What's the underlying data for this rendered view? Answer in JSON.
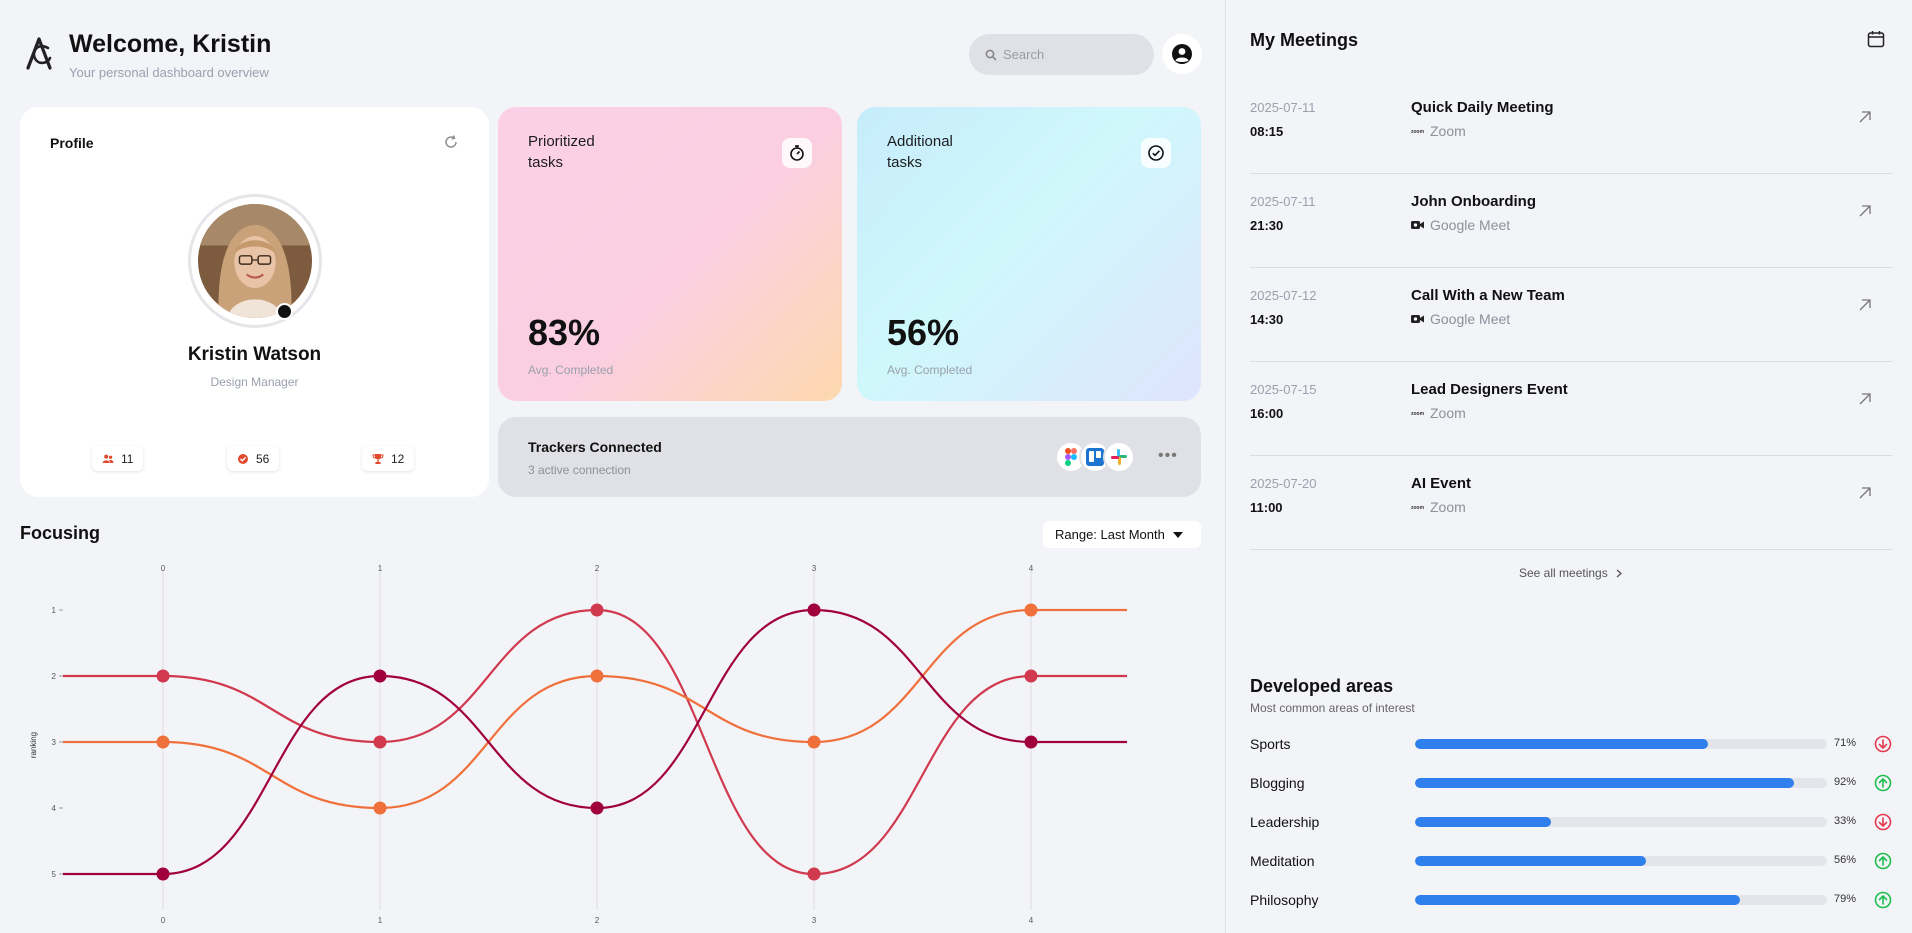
{
  "header": {
    "welcome": "Welcome, Kristin",
    "subtitle": "Your personal dashboard overview",
    "search_placeholder": "Search"
  },
  "profile": {
    "title": "Profile",
    "name": "Kristin Watson",
    "role": "Design Manager",
    "stats": [
      {
        "icon": "users-icon",
        "value": "11"
      },
      {
        "icon": "target-icon",
        "value": "56"
      },
      {
        "icon": "trophy-icon",
        "value": "12"
      }
    ]
  },
  "tasks": [
    {
      "label": "Prioritized tasks",
      "value": "83%",
      "sub": "Avg. Completed",
      "icon": "stopwatch-icon"
    },
    {
      "label": "Additional tasks",
      "value": "56%",
      "sub": "Avg. Completed",
      "icon": "check-circle-icon"
    }
  ],
  "trackers": {
    "title": "Trackers Connected",
    "subtitle": "3 active connection",
    "apps": [
      "figma-icon",
      "trello-icon",
      "slack-icon"
    ]
  },
  "focusing": {
    "title": "Focusing",
    "range_label": "Range: Last Month"
  },
  "chart_data": {
    "type": "line",
    "x": [
      0,
      1,
      2,
      3,
      4
    ],
    "x_ticks": [
      "0",
      "1",
      "2",
      "3",
      "4"
    ],
    "y_ticks": [
      "1",
      "2",
      "3",
      "4",
      "5"
    ],
    "ylabel": "ranking",
    "ylim": [
      1,
      5
    ],
    "y_reversed": true,
    "series": [
      {
        "color": "#d0394e",
        "values": [
          2,
          3,
          1,
          5,
          2
        ]
      },
      {
        "color": "#f0703c",
        "values": [
          3,
          4,
          2,
          3,
          1
        ]
      },
      {
        "color": "#a1003f",
        "values": [
          5,
          2,
          4,
          1,
          3
        ]
      }
    ]
  },
  "meetings": {
    "title": "My Meetings",
    "items": [
      {
        "date": "2025-07-11",
        "time": "08:15",
        "name": "Quick Daily Meeting",
        "platform": "Zoom",
        "platform_icon": "zoom-icon"
      },
      {
        "date": "2025-07-11",
        "time": "21:30",
        "name": "John Onboarding",
        "platform": "Google Meet",
        "platform_icon": "video-camera-icon"
      },
      {
        "date": "2025-07-12",
        "time": "14:30",
        "name": "Call With a New Team",
        "platform": "Google Meet",
        "platform_icon": "video-camera-icon"
      },
      {
        "date": "2025-07-15",
        "time": "16:00",
        "name": "Lead Designers Event",
        "platform": "Zoom",
        "platform_icon": "zoom-icon"
      },
      {
        "date": "2025-07-20",
        "time": "11:00",
        "name": "AI Event",
        "platform": "Zoom",
        "platform_icon": "zoom-icon"
      }
    ],
    "see_all": "See all meetings"
  },
  "developed_areas": {
    "title": "Developed areas",
    "subtitle": "Most common areas of interest",
    "items": [
      {
        "name": "Sports",
        "pct": "71%",
        "value": 71,
        "trend": "down"
      },
      {
        "name": "Blogging",
        "pct": "92%",
        "value": 92,
        "trend": "up"
      },
      {
        "name": "Leadership",
        "pct": "33%",
        "value": 33,
        "trend": "down"
      },
      {
        "name": "Meditation",
        "pct": "56%",
        "value": 56,
        "trend": "up"
      },
      {
        "name": "Philosophy",
        "pct": "79%",
        "value": 79,
        "trend": "up"
      }
    ]
  },
  "colors": {
    "accent": "#2f80ed",
    "trend_up": "#1fbf4f",
    "trend_down": "#e53950"
  }
}
